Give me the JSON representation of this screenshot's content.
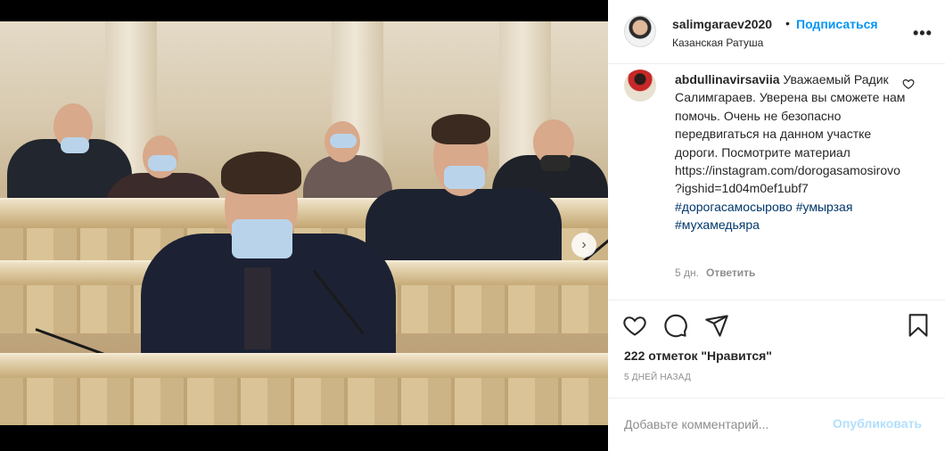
{
  "post": {
    "author": "salimgaraev2020",
    "separator": "•",
    "follow_label": "Подписаться",
    "location": "Казанская Ратуша",
    "more_label": "•••"
  },
  "comment": {
    "username": "abdullinavirsaviia",
    "text": "Уважаемый Радик Салимгараев. Уверена вы сможете нам помочь. Очень не безопасно передвигаться на данном участке дороги. Посмотрите материал https://instagram.com/dorogasamosirovo?igshid=1d04m0ef1ubf7",
    "hashtags": [
      "#дорогасамосырово",
      "#умырзая",
      "#мухамедьяра"
    ],
    "age": "5 дн.",
    "reply_label": "Ответить"
  },
  "actions": {
    "likes": "222 отметок \"Нравится\"",
    "date": "5 ДНЕЙ НАЗАД"
  },
  "add_comment": {
    "placeholder": "Добавьте комментарий...",
    "publish_label": "Опубликовать"
  },
  "media": {
    "next_arrow": "›",
    "carousel": {
      "count": 2,
      "active": 1
    }
  },
  "icons": {
    "like": "heart-icon",
    "comment": "comment-bubble-icon",
    "share": "paper-plane-icon",
    "save": "bookmark-icon",
    "comment_like": "heart-outline-icon"
  },
  "colors": {
    "accent": "#0095f6",
    "hashtag": "#00376b",
    "muted": "#8e8e8e",
    "publish_disabled": "#b2dffc"
  }
}
